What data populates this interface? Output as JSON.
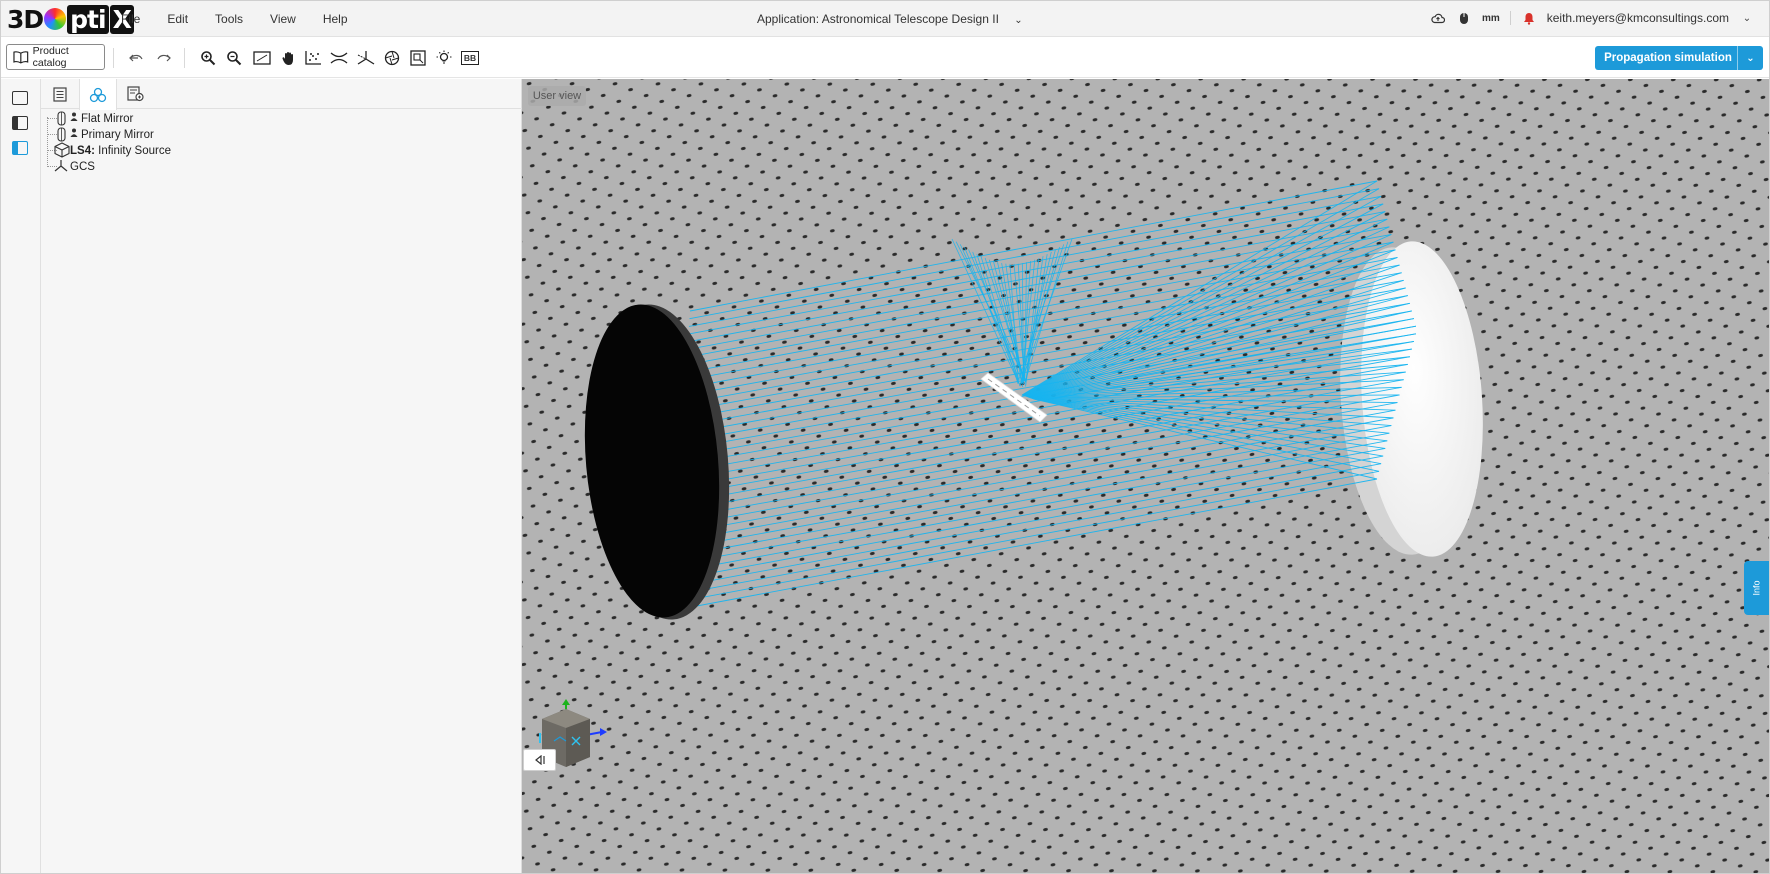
{
  "menubar": {
    "logo": {
      "part1": "3D",
      "part2": "pti",
      "part3": "X"
    },
    "menu": [
      "File",
      "Edit",
      "Tools",
      "View",
      "Help"
    ],
    "app_title": "Application: Astronomical Telescope Design II",
    "unit": "mm",
    "user_email": "keith.meyers@kmconsultings.com"
  },
  "toolbar": {
    "catalog_label": "Product catalog",
    "propagation_label": "Propagation simulation",
    "icons": [
      "undo-icon",
      "redo-icon",
      "zoom-in-icon",
      "zoom-out-icon",
      "fit-view-icon",
      "pan-hand-icon",
      "scatter-plot-icon",
      "lens-icon",
      "axis-icon",
      "aperture-icon",
      "measure-icon",
      "light-bulb-icon",
      "bb-icon"
    ],
    "bb_label": "BB"
  },
  "tree": {
    "items": [
      {
        "label": "Flat Mirror",
        "prefix": "",
        "icon": "mirror-icon"
      },
      {
        "label": "Primary Mirror",
        "prefix": "",
        "icon": "mirror-icon"
      },
      {
        "label": "Infinity Source",
        "prefix": "LS4:",
        "icon": "cube-icon"
      },
      {
        "label": "GCS",
        "prefix": "",
        "icon": "axis-icon"
      }
    ]
  },
  "viewport": {
    "view_label": "User view",
    "info_label": "Info",
    "background_color": "#b3b3b3",
    "ray_color": "#18b4ef"
  },
  "colors": {
    "accent": "#1d9ad9",
    "notification": "#d9322b"
  }
}
